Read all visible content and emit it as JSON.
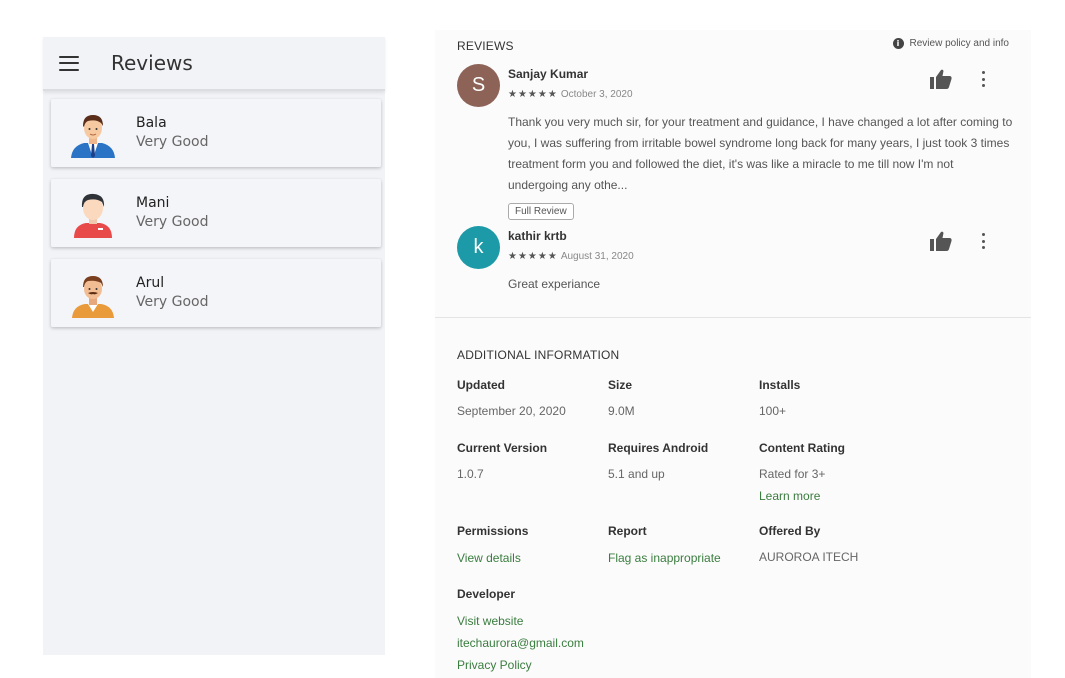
{
  "app": {
    "title": "Reviews",
    "items": [
      {
        "name": "Bala",
        "rating": "Very Good",
        "avatar": "businessman-avatar"
      },
      {
        "name": "Mani",
        "rating": "Very Good",
        "avatar": "man-red-shirt-avatar"
      },
      {
        "name": "Arul",
        "rating": "Very Good",
        "avatar": "man-mustache-avatar"
      }
    ]
  },
  "reviews": {
    "heading": "REVIEWS",
    "policy_label": "Review policy and info",
    "items": [
      {
        "initial": "S",
        "avatar_color": "#8d6358",
        "author": "Sanjay Kumar",
        "stars": "★★★★★",
        "date": "October 3, 2020",
        "body": "Thank you very much sir, for your treatment and guidance, I have changed a lot after coming to you, I was suffering from irritable bowel syndrome long back for many years, I just took 3 times treatment form you and followed the diet, it's was like a miracle to me till now I'm not undergoing any othe...",
        "full_review_label": "Full Review"
      },
      {
        "initial": "k",
        "avatar_color": "#1d9aa7",
        "author": "kathir krtb",
        "stars": "★★★★★",
        "date": "August 31, 2020",
        "body": "Great experiance"
      }
    ]
  },
  "additional": {
    "heading": "ADDITIONAL INFORMATION",
    "updated": {
      "label": "Updated",
      "value": "September 20, 2020"
    },
    "size": {
      "label": "Size",
      "value": "9.0M"
    },
    "installs": {
      "label": "Installs",
      "value": "100+"
    },
    "current_version": {
      "label": "Current Version",
      "value": "1.0.7"
    },
    "requires_android": {
      "label": "Requires Android",
      "value": "5.1 and up"
    },
    "content_rating": {
      "label": "Content Rating",
      "value": "Rated for 3+",
      "link": "Learn more"
    },
    "permissions": {
      "label": "Permissions",
      "link": "View details"
    },
    "report": {
      "label": "Report",
      "link": "Flag as inappropriate"
    },
    "offered_by": {
      "label": "Offered By",
      "value": "AUROROA ITECH"
    },
    "developer": {
      "label": "Developer",
      "links": [
        "Visit website",
        "itechaurora@gmail.com",
        "Privacy Policy"
      ]
    }
  },
  "colors": {
    "link": "#3a7d3f",
    "panel_bg": "#f2f3f7"
  }
}
